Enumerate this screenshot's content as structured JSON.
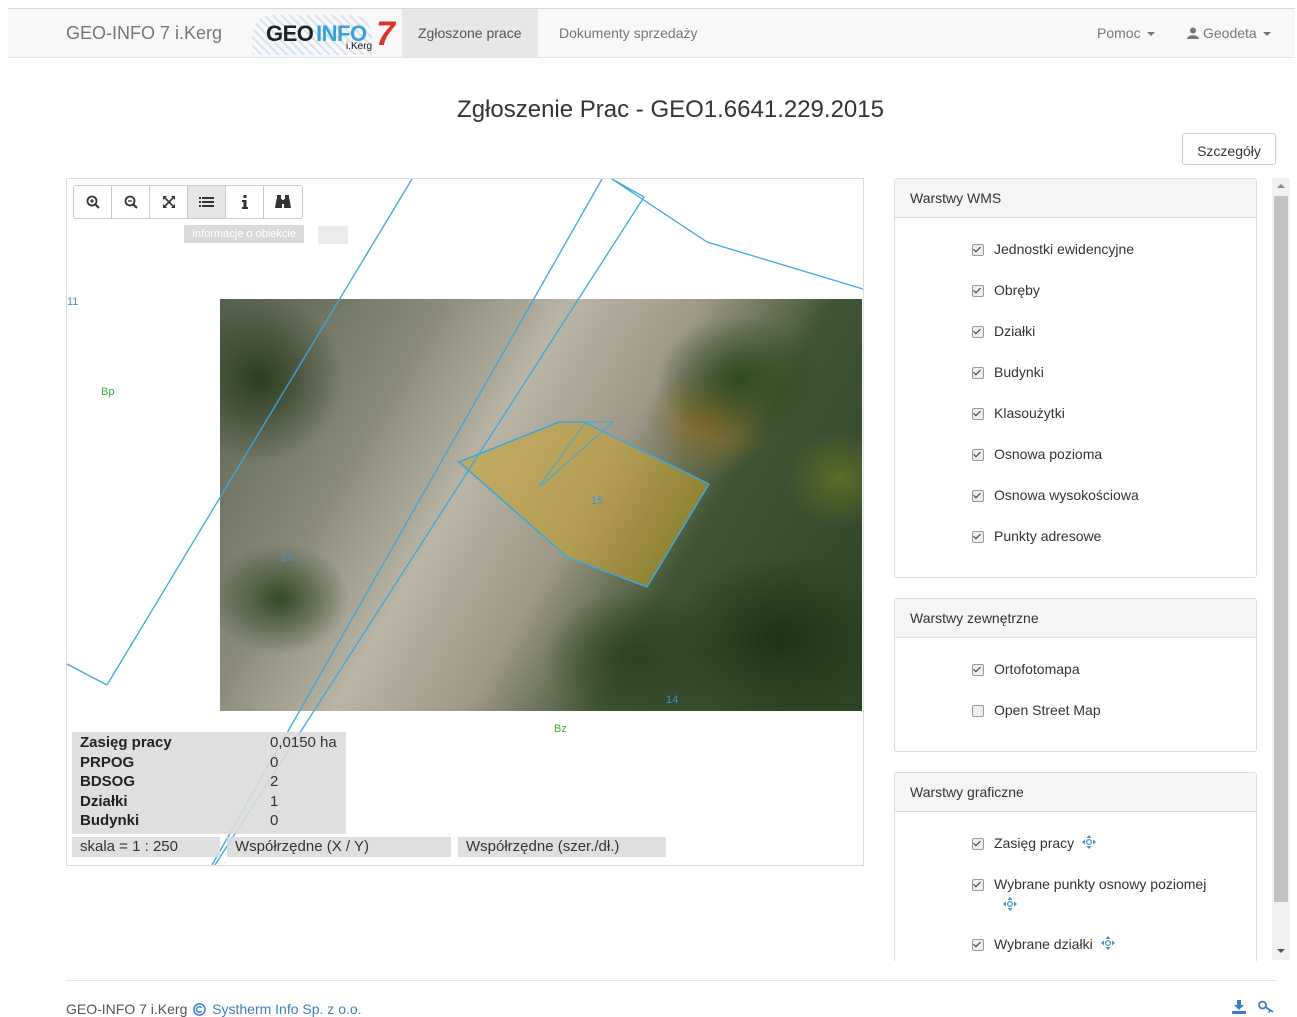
{
  "navbar": {
    "brand": "GEO-INFO 7 i.Kerg",
    "logo": {
      "geo": "GEO",
      "info": "INFO",
      "seven": "7",
      "kerg": "i.Kerg"
    },
    "tabs": [
      {
        "label": "Zgłoszone prace",
        "active": true
      },
      {
        "label": "Dokumenty sprzedaży",
        "active": false
      }
    ],
    "help_label": "Pomoc",
    "user_label": "Geodeta"
  },
  "page": {
    "title": "Zgłoszenie Prac - GEO1.6641.229.2015",
    "details_button": "Szczegóły"
  },
  "map": {
    "toolbar": [
      {
        "icon": "zoom-in-icon"
      },
      {
        "icon": "zoom-out-icon"
      },
      {
        "icon": "fullscreen-icon"
      },
      {
        "icon": "list-icon",
        "active": true
      },
      {
        "icon": "info-icon"
      },
      {
        "icon": "binoculars-icon"
      }
    ],
    "tooltip": "Informacje o obiekcie",
    "labels": {
      "bp": "Bp",
      "bz": "Bz",
      "n13": "13",
      "n15": "15",
      "n14": "14",
      "n11": "11"
    },
    "stats": [
      {
        "key": "Zasięg pracy",
        "value": "0,0150 ha"
      },
      {
        "key": "PRPOG",
        "value": "0"
      },
      {
        "key": "BDSOG",
        "value": "2"
      },
      {
        "key": "Działki",
        "value": "1"
      },
      {
        "key": "Budynki",
        "value": "0"
      }
    ],
    "scale": "skala = 1 : 250",
    "coords_xy": "Współrzędne (X / Y)",
    "coords_geo": "Współrzędne (szer./dł.)"
  },
  "panels": {
    "wms": {
      "title": "Warstwy WMS",
      "layers": [
        {
          "label": "Jednostki ewidencyjne",
          "checked": true
        },
        {
          "label": "Obręby",
          "checked": true
        },
        {
          "label": "Działki",
          "checked": true
        },
        {
          "label": "Budynki",
          "checked": true
        },
        {
          "label": "Klasoużytki",
          "checked": true
        },
        {
          "label": "Osnowa pozioma",
          "checked": true
        },
        {
          "label": "Osnowa wysokościowa",
          "checked": true
        },
        {
          "label": "Punkty adresowe",
          "checked": true
        }
      ]
    },
    "external": {
      "title": "Warstwy zewnętrzne",
      "layers": [
        {
          "label": "Ortofotomapa",
          "checked": true
        },
        {
          "label": "Open Street Map",
          "checked": false
        }
      ]
    },
    "graphic": {
      "title": "Warstwy graficzne",
      "layers": [
        {
          "label": "Zasięg pracy",
          "checked": true
        },
        {
          "label": "Wybrane punkty osnowy poziomej",
          "checked": true
        },
        {
          "label": "Wybrane działki",
          "checked": true
        }
      ]
    }
  },
  "footer": {
    "text": "GEO-INFO 7 i.Kerg",
    "copyright": "Systherm Info Sp. z o.o."
  },
  "colors": {
    "parcel_line": "#3aa8e0",
    "work_area_fill": "#c9a22c",
    "link": "#3a7fc4"
  }
}
